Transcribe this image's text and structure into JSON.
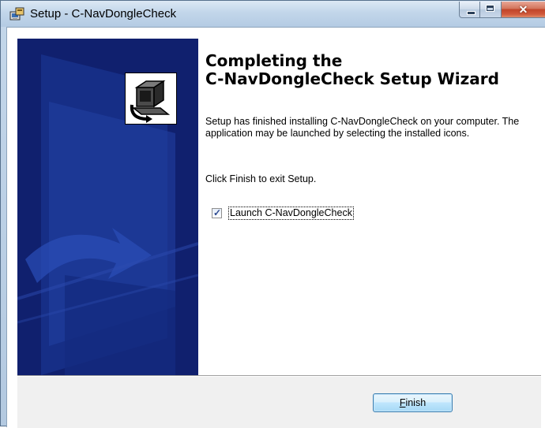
{
  "window": {
    "title": "Setup - C-NavDongleCheck"
  },
  "wizard": {
    "heading_line1": "Completing the",
    "heading_line2": "C-NavDongleCheck Setup Wizard",
    "paragraph1": "Setup has finished installing C-NavDongleCheck on your computer. The application may be launched by selecting the installed icons.",
    "paragraph2": "Click Finish to exit Setup.",
    "launch_checkbox_label": "Launch C-NavDongleCheck",
    "launch_checked": true
  },
  "footer": {
    "finish_accel": "F",
    "finish_rest": "inish"
  },
  "icons": {
    "title_icon": "setup-installer-icon",
    "wizard_image": "computer-install-icon",
    "minimize": "minimize-icon",
    "maximize": "maximize-icon",
    "close": "close-icon"
  },
  "colors": {
    "banner_blue": "#10206e",
    "close_red": "#c1452a",
    "button_blue": "#bee6fd"
  }
}
